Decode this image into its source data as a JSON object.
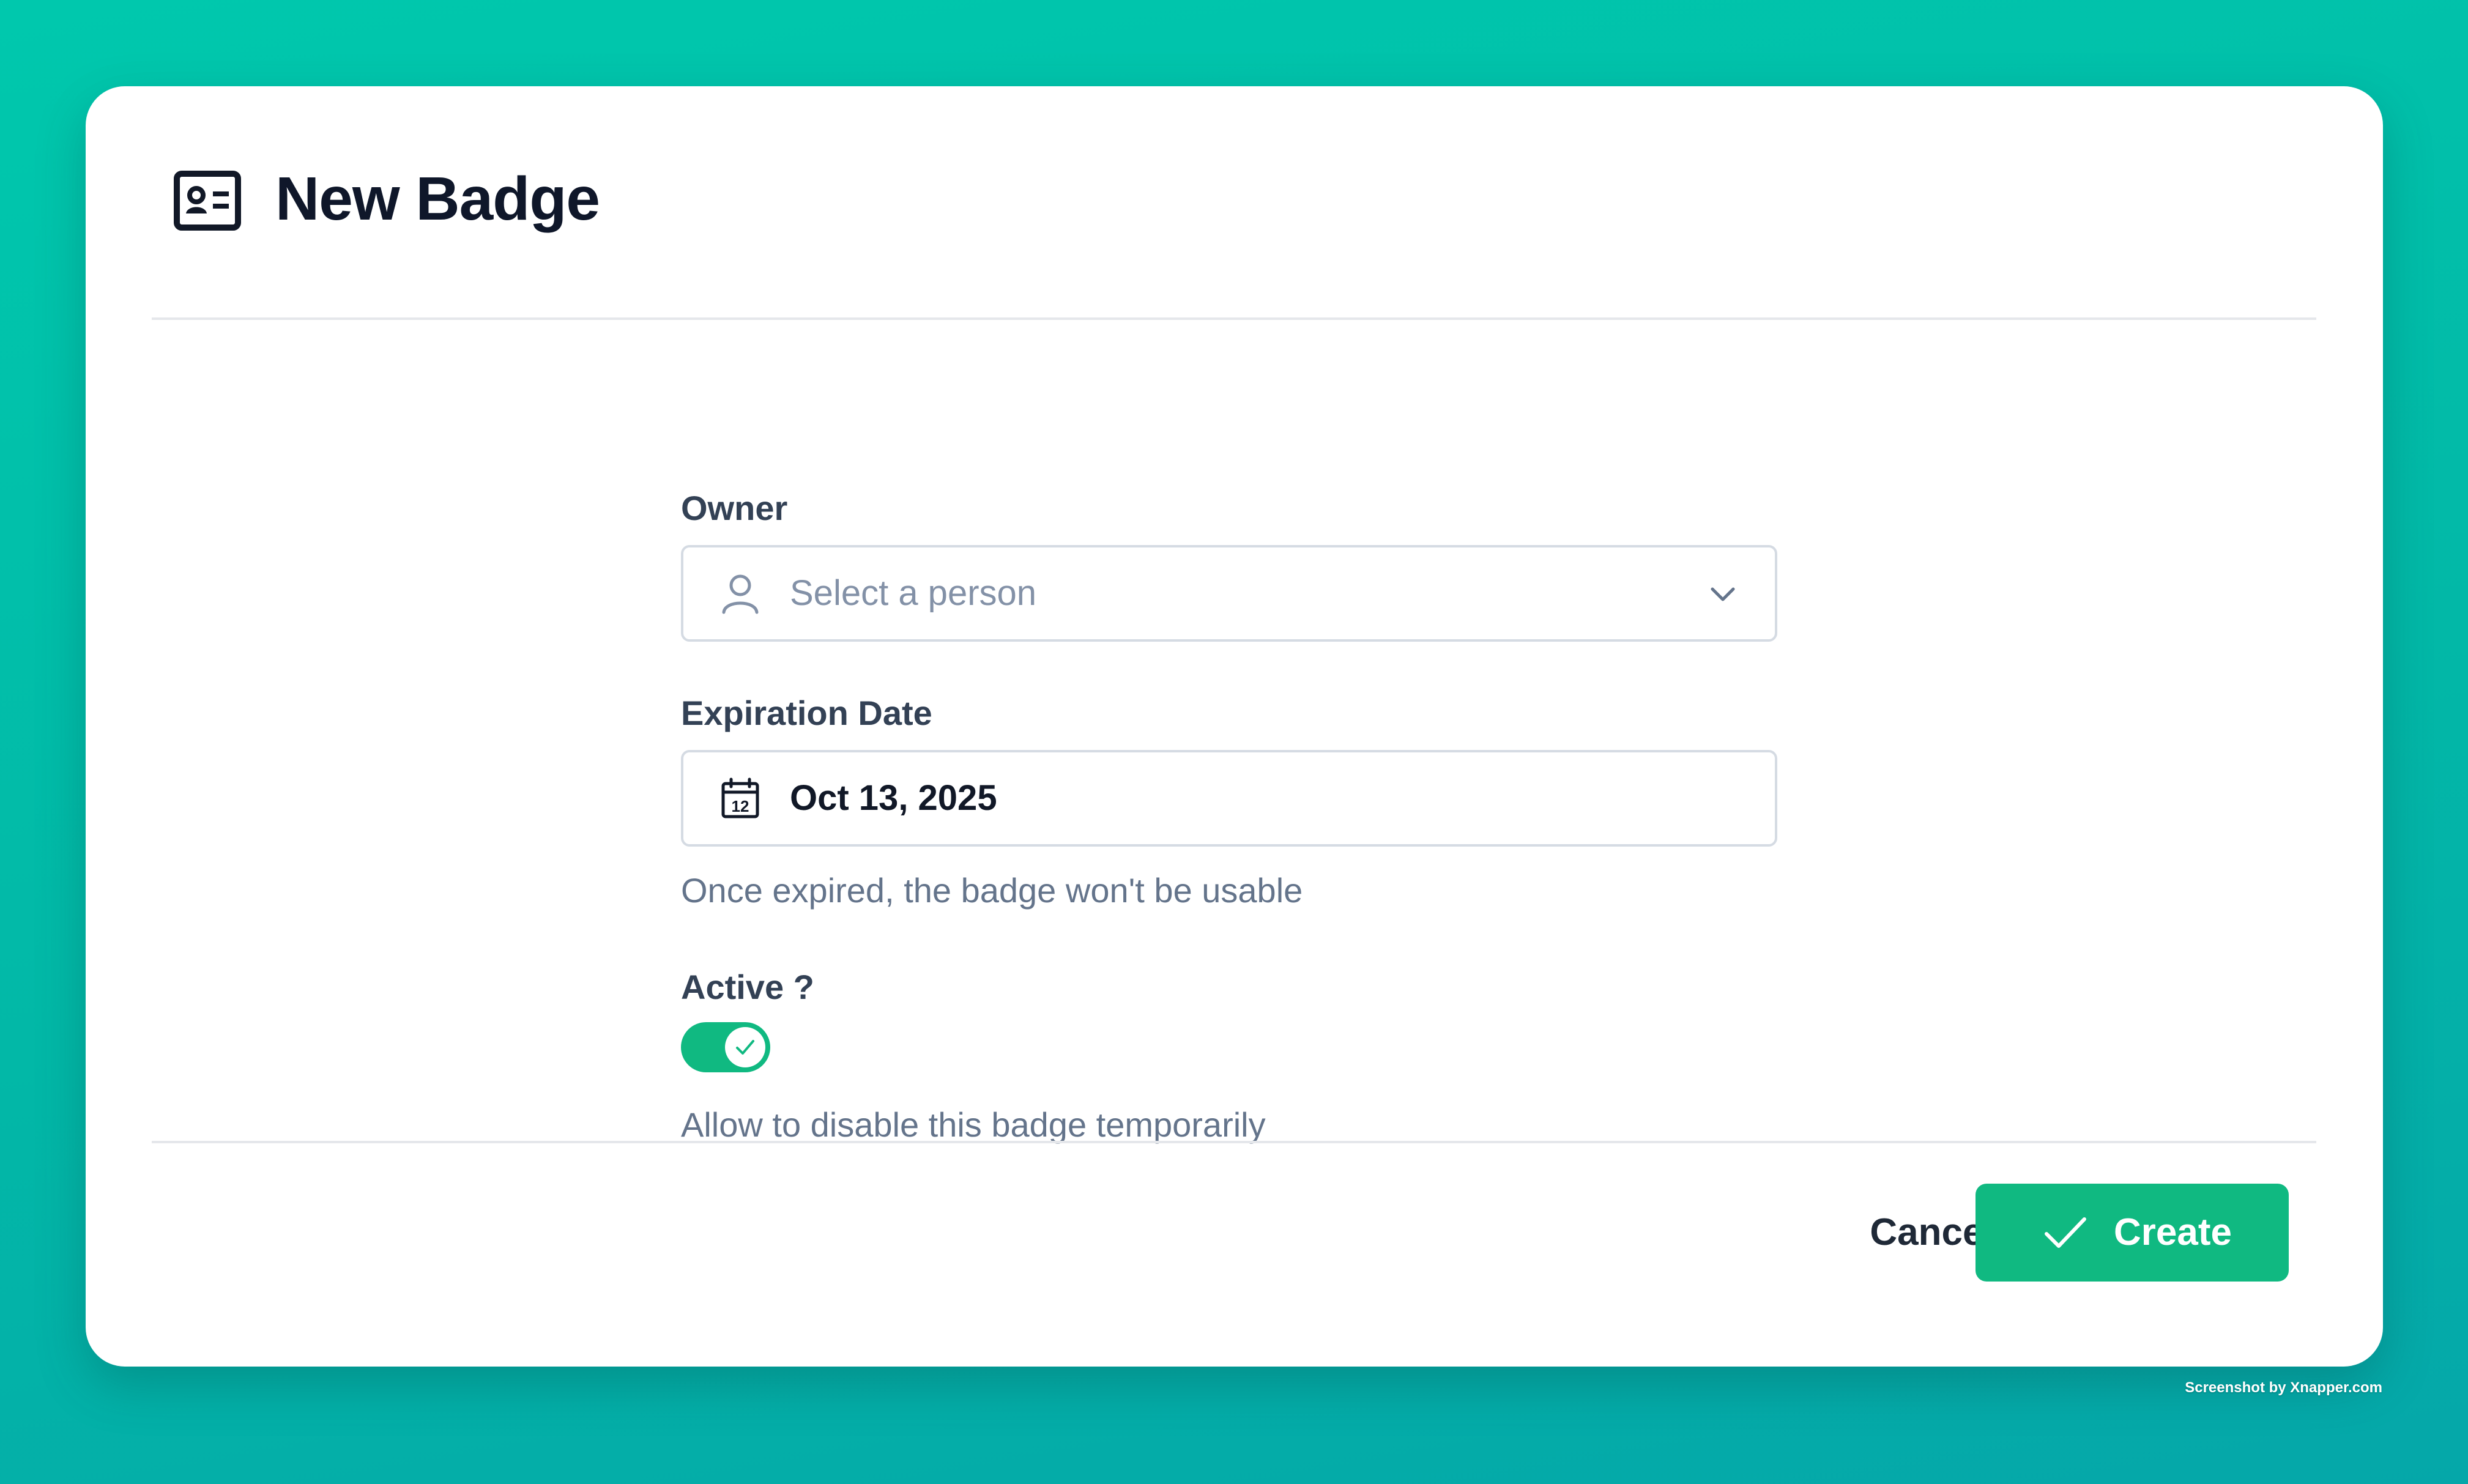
{
  "dialog": {
    "title": "New Badge",
    "header_icon": "id-card-icon"
  },
  "form": {
    "owner": {
      "label": "Owner",
      "placeholder": "Select a person",
      "icon": "user-icon",
      "trailing_icon": "chevron-down-icon"
    },
    "expiration": {
      "label": "Expiration Date",
      "value": "Oct 13, 2025",
      "icon": "calendar-icon",
      "help": "Once expired, the badge won't be usable"
    },
    "active": {
      "label": "Active ?",
      "checked": true,
      "help": "Allow to disable this badge temporarily"
    }
  },
  "actions": {
    "cancel_label": "Cancel",
    "create_label": "Create",
    "create_icon": "check-icon"
  },
  "watermark": "Screenshot by Xnapper.com",
  "colors": {
    "accent": "#10b981",
    "background_start": "#00c8ad",
    "background_end": "#05a7a9",
    "label": "#334155",
    "muted": "#64748b",
    "border": "#d5dbe3"
  }
}
